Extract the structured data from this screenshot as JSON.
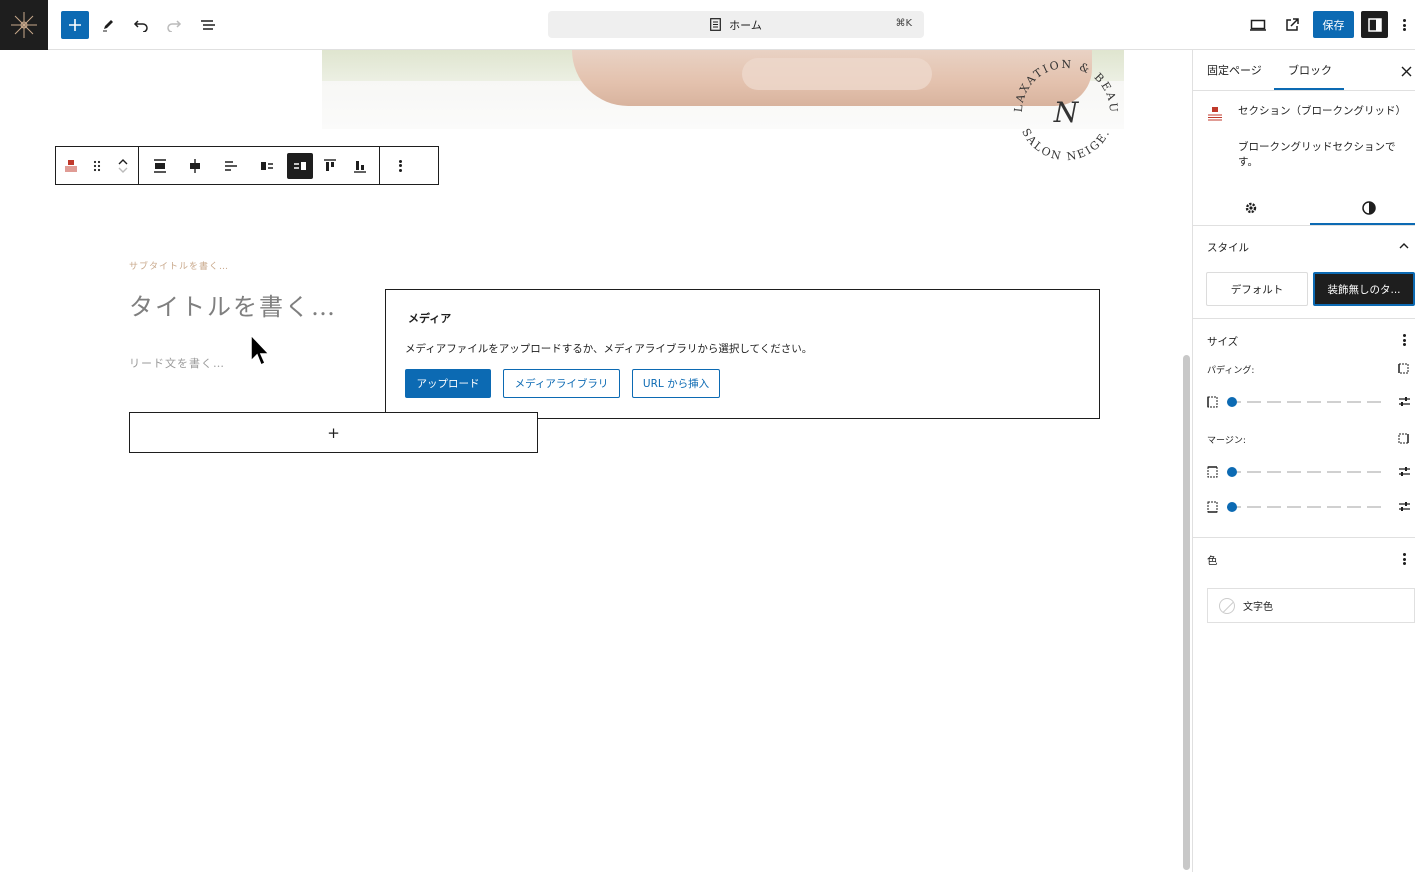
{
  "topbar": {
    "document_title": "ホーム",
    "shortcut": "⌘K",
    "save_label": "保存"
  },
  "canvas": {
    "seal_text_top": "RELAXATION & BEAUTY",
    "seal_text_bottom": "SALON NEIGE.",
    "seal_monogram": "N",
    "subtitle_placeholder": "サブタイトルを書く…",
    "title_placeholder": "タイトルを書く…",
    "lead_placeholder": "リード文を書く…",
    "appender_label": "+",
    "media": {
      "title": "メディア",
      "description": "メディアファイルをアップロードするか、メディアライブラリから選択してください。",
      "upload_label": "アップロード",
      "library_label": "メディアライブラリ",
      "url_label": "URL から挿入"
    }
  },
  "sidebar": {
    "tabs": [
      "固定ページ",
      "ブロック"
    ],
    "block_card": {
      "title": "セクション（ブロークングリッド）",
      "description": "ブロークングリッドセクションです。"
    },
    "style_section_label": "スタイル",
    "style_options": [
      "デフォルト",
      "装飾無しのタ..."
    ],
    "size_section_label": "サイズ",
    "padding_label": "パディング:",
    "margin_label": "マージン:",
    "padding_value": 0,
    "margin_top_value": 0,
    "margin_bottom_value": 0,
    "color_section_label": "色",
    "text_color_label": "文字色"
  },
  "colors": {
    "accent": "#0c6ab3",
    "dark": "#1e1e1e",
    "subtitle_gold": "#c9a98c",
    "block_icon_red": "#c0392b"
  }
}
